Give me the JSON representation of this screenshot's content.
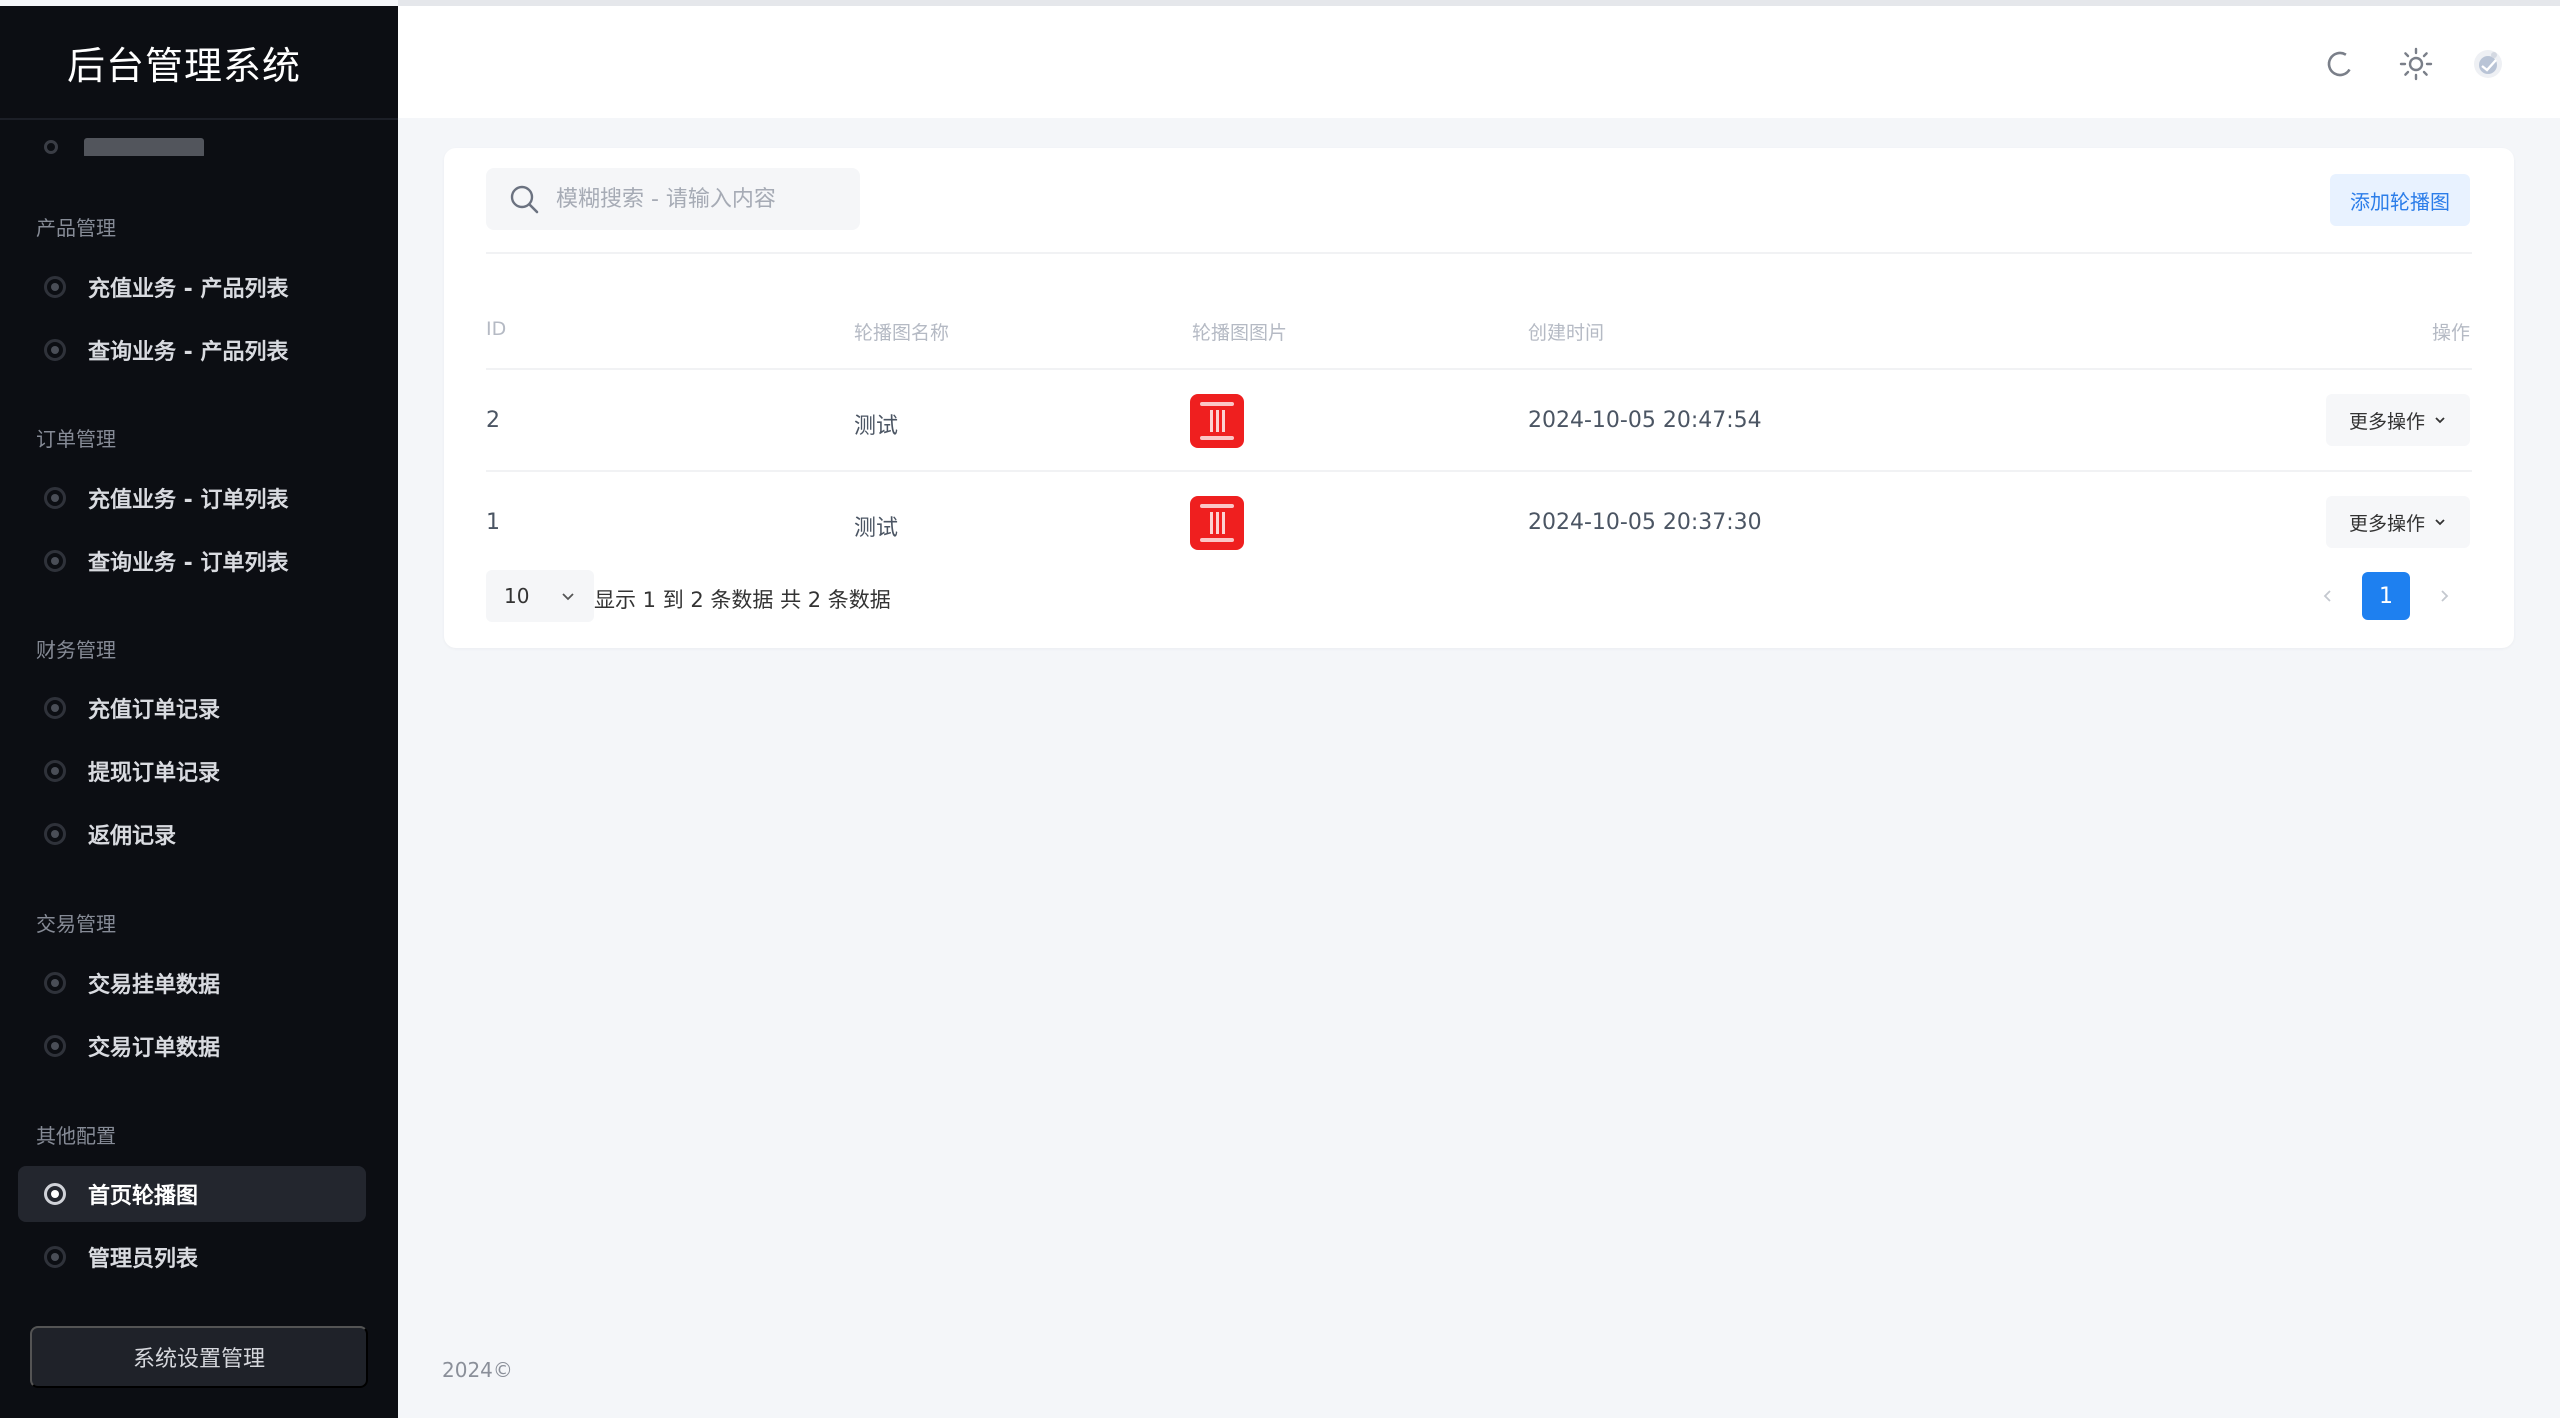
{
  "app": {
    "title": "后台管理系统"
  },
  "sidebar": {
    "groups": [
      {
        "label": "产品管理",
        "items": [
          {
            "label": "充值业务 - 产品列表"
          },
          {
            "label": "查询业务 - 产品列表"
          }
        ]
      },
      {
        "label": "订单管理",
        "items": [
          {
            "label": "充值业务 - 订单列表"
          },
          {
            "label": "查询业务 - 订单列表"
          }
        ]
      },
      {
        "label": "财务管理",
        "items": [
          {
            "label": "充值订单记录"
          },
          {
            "label": "提现订单记录"
          },
          {
            "label": "返佣记录"
          }
        ]
      },
      {
        "label": "交易管理",
        "items": [
          {
            "label": "交易挂单数据"
          },
          {
            "label": "交易订单数据"
          }
        ]
      },
      {
        "label": "其他配置",
        "items": [
          {
            "label": "首页轮播图",
            "active": true
          },
          {
            "label": "管理员列表"
          }
        ]
      }
    ],
    "settings_label": "系统设置管理"
  },
  "topbar": {
    "icons": [
      "refresh-icon",
      "theme-sun-icon",
      "avatar"
    ]
  },
  "toolbar": {
    "search_placeholder": "模糊搜索 - 请输入内容",
    "add_label": "添加轮播图"
  },
  "table": {
    "headers": {
      "id": "ID",
      "name": "轮播图名称",
      "image": "轮播图图片",
      "created": "创建时间",
      "actions": "操作"
    },
    "rows": [
      {
        "id": "2",
        "name": "测试",
        "created": "2024-10-05 20:47:54",
        "action": "更多操作"
      },
      {
        "id": "1",
        "name": "测试",
        "created": "2024-10-05 20:37:30",
        "action": "更多操作"
      }
    ]
  },
  "pagination": {
    "page_size": "10",
    "info": "显示 1 到 2 条数据 共 2 条数据",
    "current": "1"
  },
  "footer": {
    "text": "2024©"
  },
  "colors": {
    "sidebar_bg": "#0c0e13",
    "accent": "#1e80f0",
    "thumb_red": "#ef1f1f"
  }
}
